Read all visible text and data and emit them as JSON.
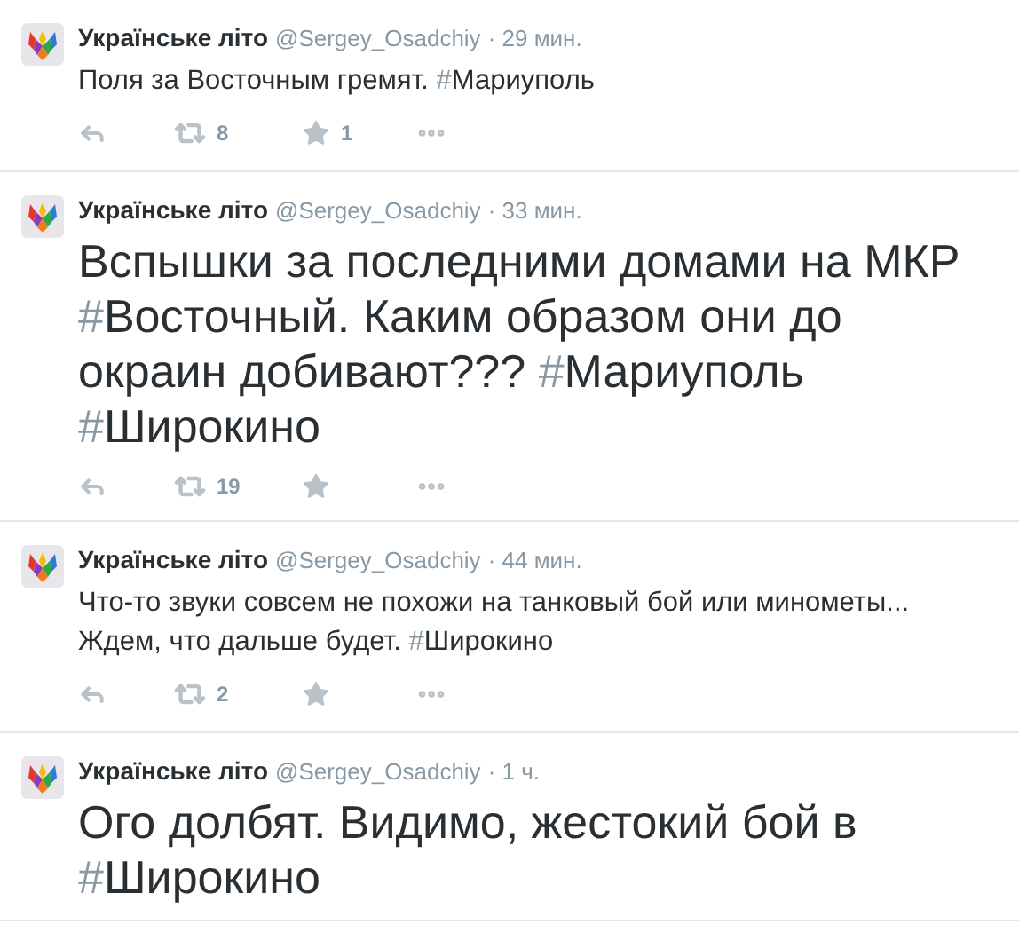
{
  "tweets": [
    {
      "name": "Українське літо",
      "handle": "@Sergey_Osadchiy",
      "time": "· 29 мин.",
      "kind": "small",
      "segments": [
        {
          "kind": "text",
          "text": "Поля за Восточным гремят. "
        },
        {
          "kind": "hashtag",
          "text": "#Мариуполь"
        }
      ],
      "retweets": "8",
      "favorites": "1"
    },
    {
      "name": "Українське літо",
      "handle": "@Sergey_Osadchiy",
      "time": "· 33 мин.",
      "kind": "large",
      "segments": [
        {
          "kind": "text",
          "text": "Вспышки за последними домами на МКР "
        },
        {
          "kind": "hashtag",
          "text": "#Восточный"
        },
        {
          "kind": "text",
          "text": ". Каким образом они до окраин добивают??? "
        },
        {
          "kind": "hashtag",
          "text": "#Мариуполь"
        },
        {
          "kind": "hashtag",
          "text": "#Широкино"
        }
      ],
      "retweets": "19"
    },
    {
      "name": "Українське літо",
      "handle": "@Sergey_Osadchiy",
      "time": "· 44 мин.",
      "kind": "small",
      "segments": [
        {
          "kind": "text",
          "text": "Что-то звуки совсем не похожи на танковый бой или минометы... Ждем, что дальше будет. "
        },
        {
          "kind": "hashtag",
          "text": "#Широкино"
        }
      ],
      "retweets": "2"
    },
    {
      "name": "Українське літо",
      "handle": "@Sergey_Osadchiy",
      "time": "· 1 ч.",
      "kind": "large",
      "segments": [
        {
          "kind": "text",
          "text": "Ого долбят. Видимо, жестокий бой в "
        },
        {
          "kind": "hashtag",
          "text": "#Широкино"
        }
      ]
    }
  ]
}
